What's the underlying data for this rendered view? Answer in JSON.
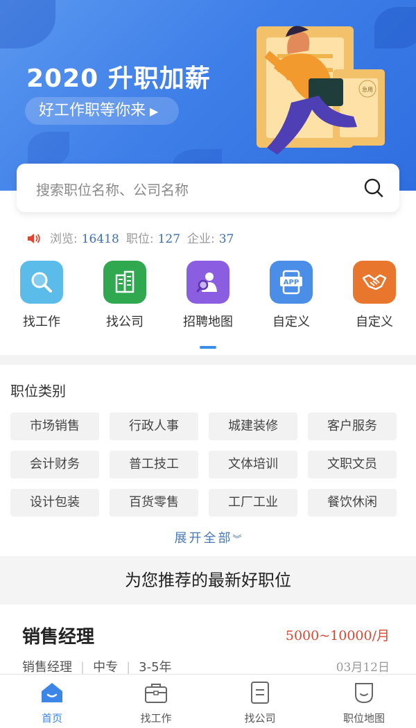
{
  "banner": {
    "title": "2020 升职加薪",
    "subtitle": "好工作职等你来",
    "badge": "急用"
  },
  "search": {
    "placeholder": "搜索职位名称、公司名称"
  },
  "stats": {
    "views_label": "浏览:",
    "views": "16418",
    "jobs_label": "职位:",
    "jobs": "127",
    "companies_label": "企业:",
    "companies": "37"
  },
  "quick_links": [
    {
      "label": "找工作",
      "icon": "magnifier-icon",
      "color": "#5bbcea"
    },
    {
      "label": "找公司",
      "icon": "building-icon",
      "color": "#2fa84f"
    },
    {
      "label": "招聘地图",
      "icon": "person-search-icon",
      "color": "#8b5de0"
    },
    {
      "label": "自定义",
      "icon": "app-phone-icon",
      "color": "#4a8ee8"
    },
    {
      "label": "自定义",
      "icon": "handshake-icon",
      "color": "#e8762c"
    }
  ],
  "categories": {
    "title": "职位类别",
    "items": [
      "市场销售",
      "行政人事",
      "城建装修",
      "客户服务",
      "会计财务",
      "普工技工",
      "文体培训",
      "文职文员",
      "设计包装",
      "百货零售",
      "工厂工业",
      "餐饮休闲"
    ],
    "expand_label": "展开全部"
  },
  "recommend": {
    "title": "为您推荐的最新好职位"
  },
  "job": {
    "title": "销售经理",
    "salary": "5000~10000/月",
    "position": "销售经理",
    "education": "中专",
    "experience": "3-5年",
    "date": "03月12日"
  },
  "tabbar": [
    {
      "label": "首页",
      "icon": "home-icon",
      "active": true
    },
    {
      "label": "找工作",
      "icon": "briefcase-icon",
      "active": false
    },
    {
      "label": "找公司",
      "icon": "document-icon",
      "active": false
    },
    {
      "label": "职位地图",
      "icon": "map-pin-icon",
      "active": false
    }
  ],
  "colors": {
    "accent": "#3b86e6",
    "salary": "#e0452f",
    "stat_number": "#3b6fb6"
  }
}
